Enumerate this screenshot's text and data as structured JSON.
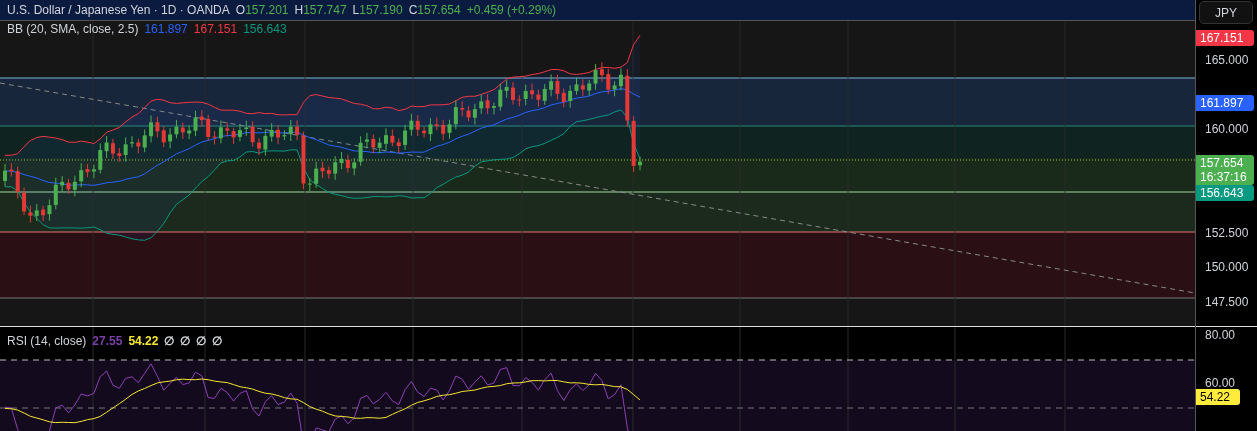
{
  "header": {
    "symbol": "U.S. Dollar / Japanese Yen · 1D · OANDA",
    "ohlc": [
      {
        "label": "O",
        "value": "157.201"
      },
      {
        "label": "H",
        "value": "157.747"
      },
      {
        "label": "L",
        "value": "157.190"
      },
      {
        "label": "C",
        "value": "157.654"
      }
    ],
    "change": "+0.459 (+0.29%)"
  },
  "bb_legend": {
    "name": "BB (20, SMA, close, 2.5)",
    "values": [
      {
        "text": "161.897",
        "color": "#2962ff"
      },
      {
        "text": "167.151",
        "color": "#f23645"
      },
      {
        "text": "156.643",
        "color": "#089981"
      }
    ]
  },
  "currency_button": "JPY",
  "price_axis": {
    "ticks": [
      "165.000",
      "160.000",
      "152.500",
      "150.000",
      "147.500"
    ],
    "labels": [
      {
        "text": "167.151",
        "color": "#f23645"
      },
      {
        "text": "161.897",
        "color": "#2962ff"
      },
      {
        "text": "157.654",
        "countdown": "16:37:16",
        "color": "#4caf50"
      },
      {
        "text": "156.643",
        "color": "#089981"
      }
    ]
  },
  "rsi_legend": {
    "name": "RSI (14, close)",
    "values": [
      {
        "text": "27.55",
        "color": "#7b3fa8"
      },
      {
        "text": "54.22",
        "color": "#f7e633"
      },
      {
        "text": "∅",
        "color": "#d1d4dc"
      },
      {
        "text": "∅",
        "color": "#d1d4dc"
      },
      {
        "text": "∅",
        "color": "#d1d4dc"
      },
      {
        "text": "∅",
        "color": "#d1d4dc"
      }
    ]
  },
  "rsi_axis": {
    "ticks": [
      "80.00",
      "60.00"
    ],
    "labels": [
      {
        "text": "54.22",
        "color": "#ffeb3b"
      }
    ]
  }
}
